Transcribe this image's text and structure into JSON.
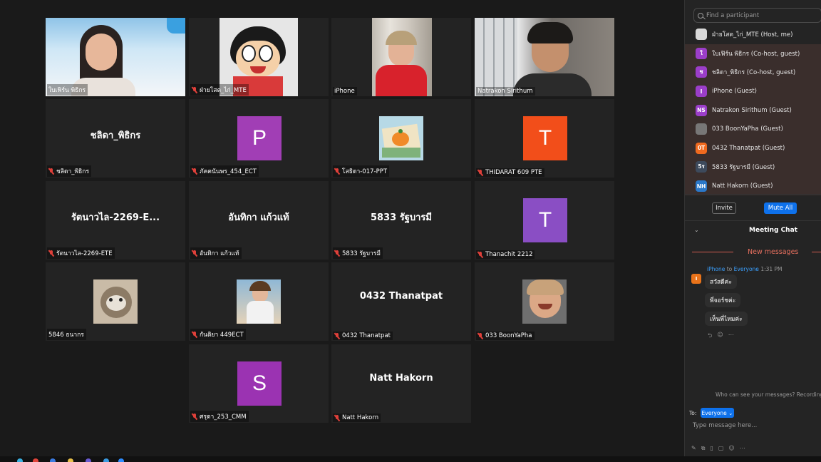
{
  "gallery": {
    "tiles": [
      {
        "label": "ใบเฟิร์น พิธิกร",
        "muted": false
      },
      {
        "label": "ฝ่ายโสต_ไก่_MTE",
        "muted": true
      },
      {
        "label": "iPhone",
        "muted": false
      },
      {
        "label": "Natrakon Sirithum",
        "muted": false,
        "active": true
      },
      {
        "label": "ชลิดา_พิธิกร",
        "center": "ชลิดา_พิธิกร",
        "muted": true
      },
      {
        "label": "ภัคคนันพร_454_ECT",
        "avatar": "P",
        "avatar_color": "#a13eb5",
        "muted": true
      },
      {
        "label": "โสธิดา-017-PPT",
        "muted": true
      },
      {
        "label": "THIDARAT 609 PTE",
        "avatar": "T",
        "avatar_color": "#f24e1a",
        "muted": true
      },
      {
        "label": "รัตนาวไล-2269-ETE",
        "center": "รัตนาวไล-2269-E...",
        "muted": true
      },
      {
        "label": "อันทิกา แก้วแท้",
        "center": "อันทิกา แก้วแท้",
        "muted": true
      },
      {
        "label": "5833 รัฐบารมี",
        "center": "5833 รัฐบารมี",
        "muted": true
      },
      {
        "label": "Thanachit 2212",
        "avatar": "T",
        "avatar_color": "#8a4ec4",
        "muted": true
      },
      {
        "label": "5846 ธนากร",
        "muted": false
      },
      {
        "label": "กันติยา 449ECT",
        "muted": true
      },
      {
        "label": "0432 Thanatpat",
        "center": "0432 Thanatpat",
        "muted": true
      },
      {
        "label": "033 BoonYaPha",
        "muted": true
      },
      {
        "label": "ศรุดา_253_CMM",
        "avatar": "S",
        "avatar_color": "#9b33b2",
        "muted": true
      },
      {
        "label": "Natt Hakorn",
        "center": "Natt Hakorn",
        "muted": true
      }
    ]
  },
  "participants": {
    "search_placeholder": "Find a participant",
    "list": [
      {
        "name": "ฝ่ายโสต_ไก่_MTE (Host, me)",
        "initials": "",
        "color": "#d9d9d9"
      },
      {
        "name": "ใบเฟิร์น พิธิกร (Co-host, guest)",
        "initials": "ใ",
        "color": "#9b3ec9"
      },
      {
        "name": "ชลิดา_พิธิกร (Co-host, guest)",
        "initials": "ช",
        "color": "#9b3ec9"
      },
      {
        "name": "iPhone (Guest)",
        "initials": "I",
        "color": "#9b3ec9"
      },
      {
        "name": "Natrakon Sirithum (Guest)",
        "initials": "NS",
        "color": "#9b3ec9"
      },
      {
        "name": "033 BoonYaPha (Guest)",
        "initials": "",
        "color": "#777777"
      },
      {
        "name": "0432 Thanatpat (Guest)",
        "initials": "0T",
        "color": "#ef6a1f"
      },
      {
        "name": "5833 รัฐบารมี (Guest)",
        "initials": "5ร",
        "color": "#3d4a5c"
      },
      {
        "name": "Natt Hakorn (Guest)",
        "initials": "NH",
        "color": "#2b78c9"
      }
    ],
    "invite_label": "Invite",
    "mute_all_label": "Mute All"
  },
  "chat": {
    "title": "Meeting Chat",
    "new_messages": "New messages",
    "sender": "iPhone",
    "to_word": "to",
    "recipient": "Everyone",
    "time": "1:31 PM",
    "sender_initial": "I",
    "messages": [
      "สวัสดีค่ะ",
      "พี่จอร์ชค่ะ",
      "เห็นพี่ไหมค่ะ"
    ],
    "who_can_see": "Who can see your messages? Recording",
    "to_label": "To:",
    "to_value": "Everyone ⌄",
    "input_placeholder": "Type message here..."
  }
}
